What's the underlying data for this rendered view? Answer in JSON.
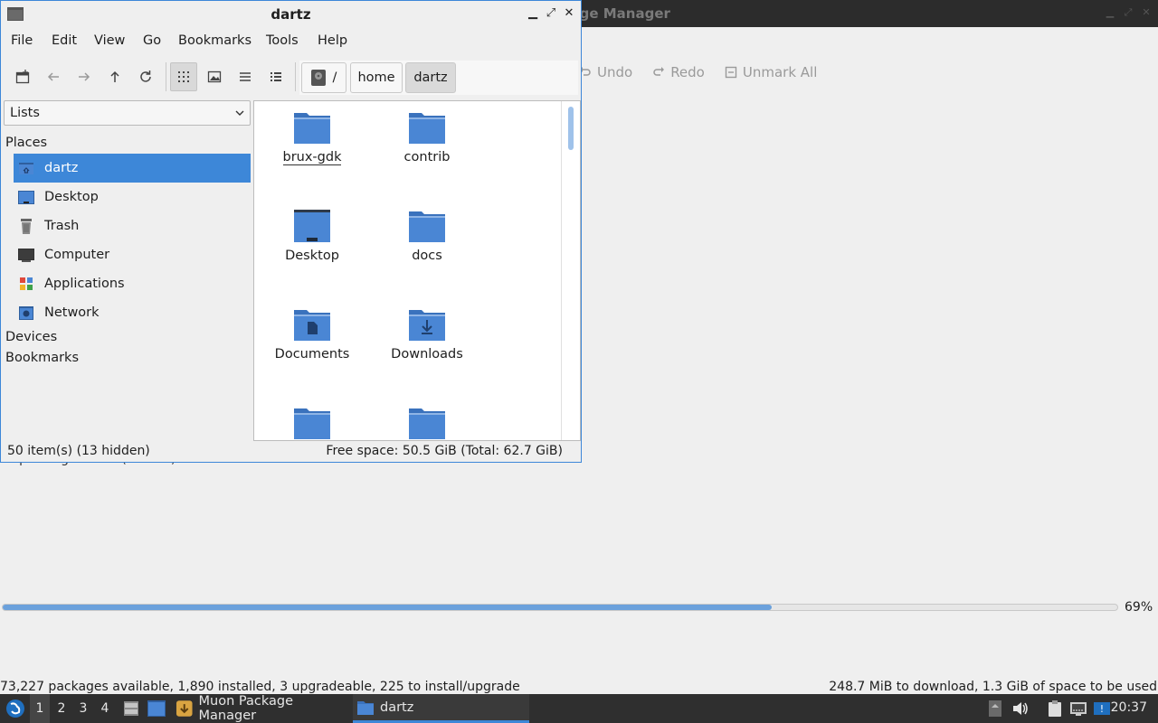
{
  "muon": {
    "title": "Muon Package Manager",
    "toolbar": {
      "undo": "Undo",
      "redo": "Redo",
      "unmark_all": "Unmark All"
    },
    "unpack_text": "Unpacking libwine (amd64)",
    "progress": {
      "fraction": 0.69,
      "label": "69%"
    },
    "status_left": "73,227 packages available, 1,890 installed, 3 upgradeable, 225 to install/upgrade",
    "status_right": "248.7 MiB to download, 1.3 GiB of space to be used"
  },
  "fm": {
    "title": "dartz",
    "menu": [
      "File",
      "Edit",
      "View",
      "Go",
      "Bookmarks",
      "Tools",
      "Help"
    ],
    "path": {
      "root": "/",
      "segments": [
        "home",
        "dartz"
      ]
    },
    "side_combo": "Lists",
    "places_header": "Places",
    "places": [
      {
        "label": "dartz",
        "icon": "home-icon",
        "selected": true
      },
      {
        "label": "Desktop",
        "icon": "desktop-icon",
        "selected": false
      },
      {
        "label": "Trash",
        "icon": "trash-icon",
        "selected": false
      },
      {
        "label": "Computer",
        "icon": "computer-icon",
        "selected": false
      },
      {
        "label": "Applications",
        "icon": "applications-icon",
        "selected": false
      },
      {
        "label": "Network",
        "icon": "network-icon",
        "selected": false
      }
    ],
    "devices_header": "Devices",
    "bookmarks_header": "Bookmarks",
    "files": [
      {
        "name": "brux-gdk",
        "icon": "folder-icon"
      },
      {
        "name": "contrib",
        "icon": "folder-icon"
      },
      {
        "name": "Desktop",
        "icon": "folder-desktop-icon"
      },
      {
        "name": "docs",
        "icon": "folder-icon"
      },
      {
        "name": "Documents",
        "icon": "folder-documents-icon"
      },
      {
        "name": "Downloads",
        "icon": "folder-downloads-icon"
      },
      {
        "name": "",
        "icon": "folder-icon"
      },
      {
        "name": "",
        "icon": "folder-icon"
      }
    ],
    "status_left": "50 item(s) (13 hidden)",
    "status_right": "Free space: 50.5 GiB (Total: 62.7 GiB)"
  },
  "taskbar": {
    "desktops": [
      "1",
      "2",
      "3",
      "4"
    ],
    "tasks": [
      {
        "label": "Muon Package Manager",
        "icon": "package-manager-icon"
      },
      {
        "label": "dartz",
        "icon": "folder-icon"
      }
    ],
    "clock": "20:37"
  },
  "colors": {
    "accent": "#3d87d8",
    "folder": "#4a86d4",
    "taskbar": "#2f2f2f"
  }
}
